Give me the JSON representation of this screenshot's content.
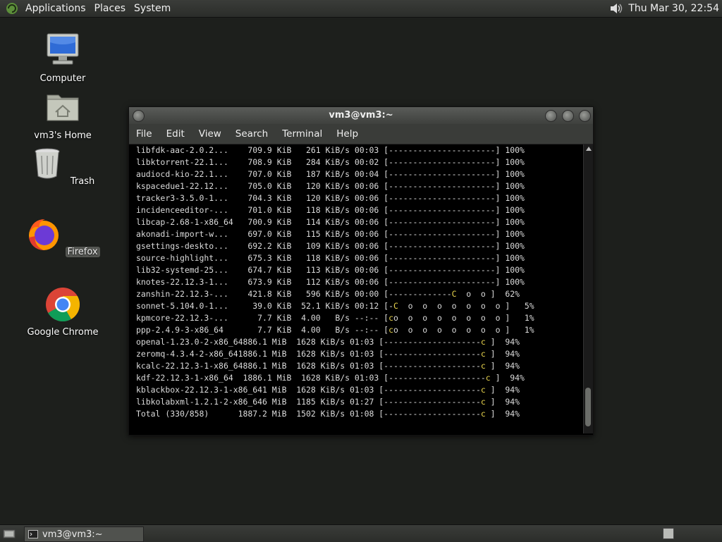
{
  "top_panel": {
    "menus": [
      "Applications",
      "Places",
      "System"
    ],
    "clock": "Thu Mar 30, 22:54"
  },
  "desktop": {
    "icons": [
      {
        "label": "Computer",
        "icon": "computer-icon"
      },
      {
        "label": "vm3's Home",
        "icon": "home-folder-icon"
      },
      {
        "label": "Trash",
        "icon": "trash-icon"
      },
      {
        "label": "Firefox",
        "icon": "firefox-icon"
      },
      {
        "label": "Google Chrome",
        "icon": "chrome-icon"
      }
    ]
  },
  "window": {
    "title": "vm3@vm3:~",
    "menus": [
      "File",
      "Edit",
      "View",
      "Search",
      "Terminal",
      "Help"
    ],
    "lines": [
      {
        "text": "libfdk-aac-2.0.2...    709.9 KiB   261 KiB/s 00:03 [----------------------] 100%"
      },
      {
        "text": "libktorrent-22.1...    708.9 KiB   284 KiB/s 00:02 [----------------------] 100%"
      },
      {
        "text": "audiocd-kio-22.1...    707.0 KiB   187 KiB/s 00:04 [----------------------] 100%"
      },
      {
        "text": "kspacedue1-22.12...    705.0 KiB   120 KiB/s 00:06 [----------------------] 100%"
      },
      {
        "text": "tracker3-3.5.0-1...    704.3 KiB   120 KiB/s 00:06 [----------------------] 100%"
      },
      {
        "text": "incidenceeditor-...    701.0 KiB   118 KiB/s 00:06 [----------------------] 100%"
      },
      {
        "text": "libcap-2.68-1-x86_64   700.9 KiB   114 KiB/s 00:06 [----------------------] 100%"
      },
      {
        "text": "akonadi-import-w...    697.0 KiB   115 KiB/s 00:06 [----------------------] 100%"
      },
      {
        "text": "gsettings-deskto...    692.2 KiB   109 KiB/s 00:06 [----------------------] 100%"
      },
      {
        "text": "source-highlight...    675.3 KiB   118 KiB/s 00:06 [----------------------] 100%"
      },
      {
        "text": "lib32-systemd-25...    674.7 KiB   113 KiB/s 00:06 [----------------------] 100%"
      },
      {
        "text": "knotes-22.12.3-1...    673.9 KiB   112 KiB/s 00:06 [----------------------] 100%"
      },
      {
        "pre": "zanshin-22.12.3-...    421.8 KiB   596 KiB/s 00:00 [-------------",
        "pac": "C",
        "post": "  o  o ]  62%"
      },
      {
        "pre": "sonnet-5.104.0-1...     39.0 KiB  52.1 KiB/s 00:12 [-",
        "pac": "C",
        "post": "  o  o  o  o  o  o  o ]   5%"
      },
      {
        "pre": "kpmcore-22.12.3-...      7.7 KiB  4.00   B/s --:-- [",
        "pac": "c",
        "post": "o  o  o  o  o  o  o  o ]   1%"
      },
      {
        "pre": "ppp-2.4.9-3-x86_64       7.7 KiB  4.00   B/s --:-- [",
        "pac": "c",
        "post": "o  o  o  o  o  o  o  o ]   1%"
      },
      {
        "pre": "openal-1.23.0-2-x86_64886.1 MiB  1628 KiB/s 01:03 [--------------------",
        "pac": "c",
        "post": " ]  94%"
      },
      {
        "pre": "zeromq-4.3.4-2-x86_641886.1 MiB  1628 KiB/s 01:03 [--------------------",
        "pac": "c",
        "post": " ]  94%"
      },
      {
        "pre": "kcalc-22.12.3-1-x86_64886.1 MiB  1628 KiB/s 01:03 [--------------------",
        "pac": "c",
        "post": " ]  94%"
      },
      {
        "pre": "kdf-22.12.3-1-x86_64  1886.1 MiB  1628 KiB/s 01:03 [--------------------",
        "pac": "c",
        "post": " ]  94%"
      },
      {
        "pre": "kblackbox-22.12.3-1-x86_641 MiB  1628 KiB/s 01:03 [--------------------",
        "pac": "c",
        "post": " ]  94%"
      },
      {
        "pre": "libkolabxml-1.2.1-2-x86_646 MiB  1185 KiB/s 01:27 [--------------------",
        "pac": "c",
        "post": " ]  94%"
      },
      {
        "pre": "Total (330/858)      1887.2 MiB  1502 KiB/s 01:08 [--------------------",
        "pac": "c",
        "post": " ]  94%"
      }
    ]
  },
  "bottom_panel": {
    "task_label": "vm3@vm3:~"
  },
  "colors": {
    "desktop_bg": "#1d1f1c",
    "panel": "#3a3c39",
    "pacman": "#e8d44d"
  }
}
